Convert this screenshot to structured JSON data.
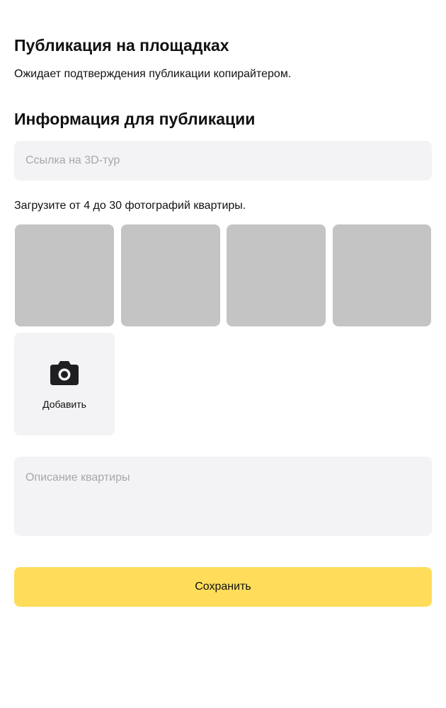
{
  "publication": {
    "title": "Публикация на площадках",
    "status": "Ожидает подтверждения публикации копирайтером."
  },
  "info": {
    "title": "Информация для публикации",
    "tour_link": {
      "placeholder": "Ссылка на 3D-тур",
      "value": ""
    },
    "upload_hint": "Загрузите от 4 до 30 фотографий квартиры.",
    "photos_count": 4,
    "add_photo": {
      "icon": "camera-icon",
      "label": "Добавить"
    },
    "description": {
      "placeholder": "Описание квартиры",
      "value": ""
    }
  },
  "actions": {
    "save_label": "Сохранить"
  },
  "colors": {
    "accent": "#ffdd5a",
    "field_background": "#f3f3f5",
    "photo_placeholder": "#c4c4c4",
    "placeholder_text": "#a7a7ab",
    "text": "#111111"
  }
}
